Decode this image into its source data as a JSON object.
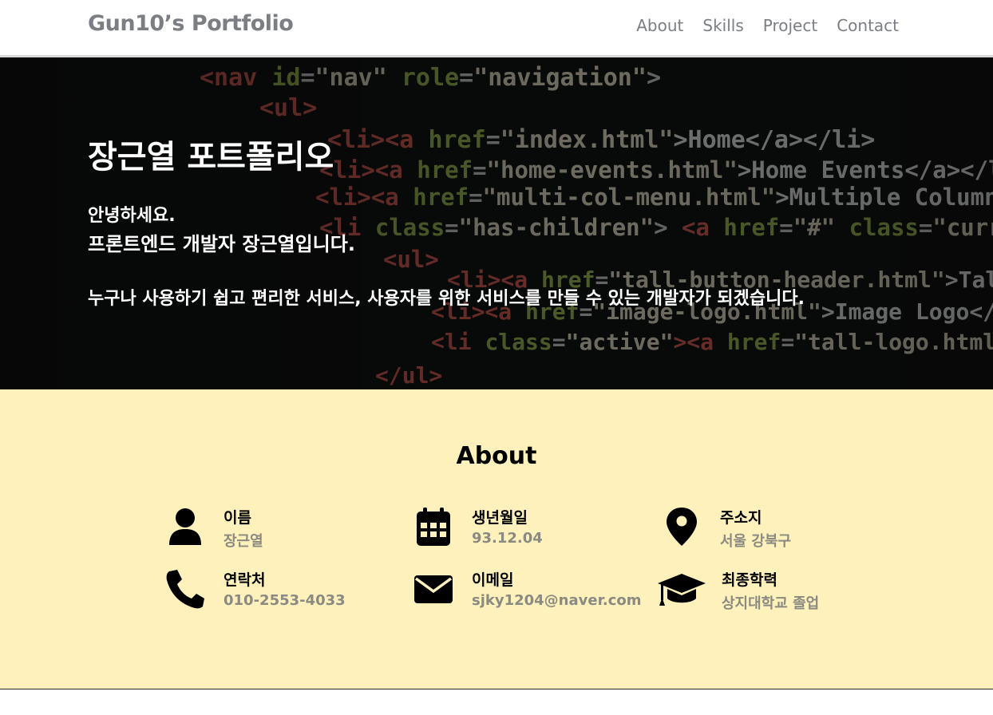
{
  "header": {
    "brand": "Gun10’s Portfolio",
    "nav": [
      "About",
      "Skills",
      "Project",
      "Contact"
    ]
  },
  "hero": {
    "title": "장근열 포트폴리오",
    "greeting": "안녕하세요.",
    "role": "프론트엔드 개발자 장근열입니다.",
    "description": "누구나 사용하기 쉽고 편리한 서비스, 사용자를 위한 서비스를 만들 수 있는 개발자가 되겠습니다."
  },
  "about": {
    "title": "About",
    "items": [
      {
        "icon": "person-icon",
        "label": "이름",
        "value": "장근열"
      },
      {
        "icon": "calendar-icon",
        "label": "생년월일",
        "value": "93.12.04"
      },
      {
        "icon": "location-pin-icon",
        "label": "주소지",
        "value": "서울 강북구"
      },
      {
        "icon": "phone-icon",
        "label": "연락처",
        "value": "010-2553-4033"
      },
      {
        "icon": "envelope-icon",
        "label": "이메일",
        "value": "sjky1204@naver.com"
      },
      {
        "icon": "graduation-cap-icon",
        "label": "최종학력",
        "value": "상지대학교 졸업"
      }
    ]
  },
  "colors": {
    "nav_text": "#7b7e83",
    "about_bg": "#fef1bb",
    "value_text": "#8a8a82"
  }
}
